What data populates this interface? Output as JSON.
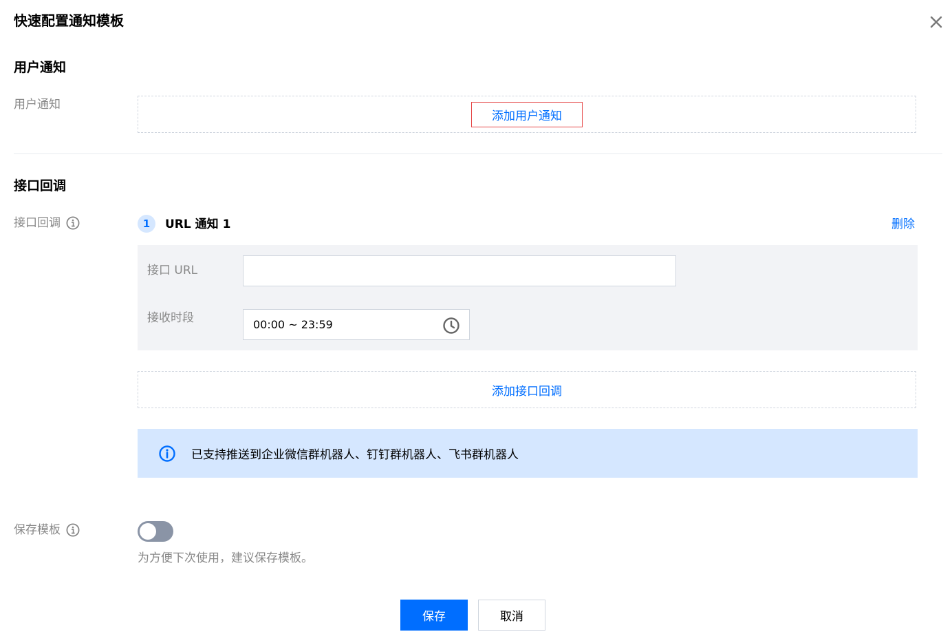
{
  "dialog": {
    "title": "快速配置通知模板"
  },
  "user_notify": {
    "section_title": "用户通知",
    "field_label": "用户通知",
    "add_button": "添加用户通知"
  },
  "callback": {
    "section_title": "接口回调",
    "field_label": "接口回调",
    "step_number": "1",
    "step_title": "URL 通知 1",
    "delete_label": "删除",
    "url_label": "接口 URL",
    "url_value": "",
    "url_placeholder": "",
    "time_label": "接收时段",
    "time_value": "00:00 ~ 23:59",
    "add_button": "添加接口回调",
    "info_text": "已支持推送到企业微信群机器人、钉钉群机器人、飞书群机器人"
  },
  "save_template": {
    "label": "保存模板",
    "toggle_on": false,
    "hint": "为方便下次使用，建议保存模板。"
  },
  "footer": {
    "save_label": "保存",
    "cancel_label": "取消"
  },
  "icons": {
    "close": "close-icon",
    "info": "info-circle-icon",
    "clock": "clock-icon"
  },
  "colors": {
    "accent": "#006eff",
    "banner_bg": "#d5e7ff",
    "panel_bg": "#f2f3f6",
    "highlight_border": "#e54545",
    "toggle_off": "#8a94a6"
  }
}
